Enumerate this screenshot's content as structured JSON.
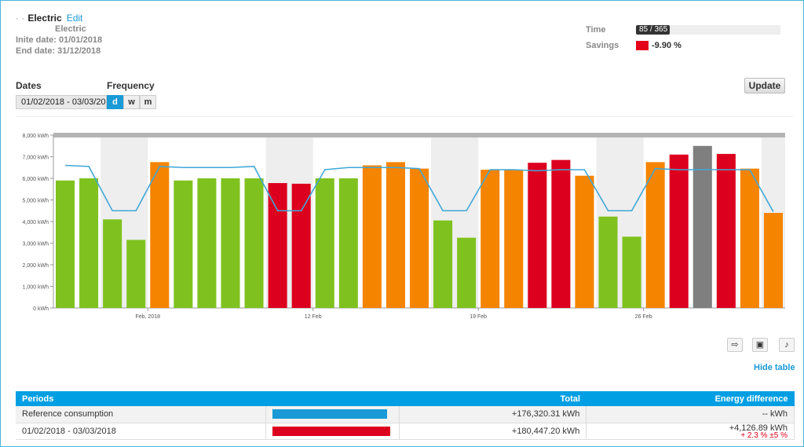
{
  "header": {
    "mask": "· ·",
    "title": "Electric",
    "edit_label": "Edit",
    "subtitle": "Electric",
    "start_date": "Inite date: 01/01/2018",
    "end_date": "End date: 31/12/2018"
  },
  "meta": {
    "time_label": "Time",
    "time_value": "85 / 365",
    "time_fraction": 0.233,
    "savings_label": "Savings",
    "savings_value": "-9.90 %",
    "savings_color": "#e2001a"
  },
  "controls": {
    "dates_label": "Dates",
    "frequency_label": "Frequency",
    "date_range_value": "01/02/2018 - 03/03/20",
    "frequency_options": [
      "d",
      "w",
      "m"
    ],
    "frequency_selected": "d",
    "update_label": "Update"
  },
  "colors": {
    "green": "#7fc21f",
    "orange": "#f58400",
    "red": "#dc001e",
    "gray": "#7f7f7f",
    "line": "#40a8d8",
    "accent": "#009fe3"
  },
  "chart_data": {
    "type": "bar",
    "y_unit": "kWh",
    "ylim": [
      0,
      8000
    ],
    "yticks": [
      "0 kWh",
      "1,000 kWh",
      "2,000 kWh",
      "3,000 kWh",
      "4,000 kWh",
      "5,000 kWh",
      "6,000 kWh",
      "7,000 kWh",
      "8,000 kWh"
    ],
    "x_ticks": [
      {
        "index": 4,
        "label": "Feb, 2018"
      },
      {
        "index": 11,
        "label": "12 Feb"
      },
      {
        "index": 18,
        "label": "19 Feb"
      },
      {
        "index": 25,
        "label": "26 Feb"
      }
    ],
    "weekend_pairs": [
      [
        2,
        3
      ],
      [
        9,
        10
      ],
      [
        16,
        17
      ],
      [
        23,
        24
      ],
      [
        30,
        31
      ]
    ],
    "bars": [
      {
        "value": 5900,
        "status": "green"
      },
      {
        "value": 6000,
        "status": "green"
      },
      {
        "value": 4100,
        "status": "green"
      },
      {
        "value": 3150,
        "status": "green"
      },
      {
        "value": 6750,
        "status": "orange"
      },
      {
        "value": 5900,
        "status": "green"
      },
      {
        "value": 6000,
        "status": "green"
      },
      {
        "value": 6000,
        "status": "green"
      },
      {
        "value": 6000,
        "status": "green"
      },
      {
        "value": 5780,
        "status": "red"
      },
      {
        "value": 5750,
        "status": "red"
      },
      {
        "value": 6000,
        "status": "green"
      },
      {
        "value": 6000,
        "status": "green"
      },
      {
        "value": 6600,
        "status": "orange"
      },
      {
        "value": 6750,
        "status": "orange"
      },
      {
        "value": 6450,
        "status": "orange"
      },
      {
        "value": 4050,
        "status": "green"
      },
      {
        "value": 3250,
        "status": "green"
      },
      {
        "value": 6400,
        "status": "orange"
      },
      {
        "value": 6400,
        "status": "orange"
      },
      {
        "value": 6720,
        "status": "red"
      },
      {
        "value": 6850,
        "status": "red"
      },
      {
        "value": 6120,
        "status": "orange"
      },
      {
        "value": 4230,
        "status": "green"
      },
      {
        "value": 3300,
        "status": "green"
      },
      {
        "value": 6750,
        "status": "orange"
      },
      {
        "value": 7100,
        "status": "red"
      },
      {
        "value": 7500,
        "status": "gray"
      },
      {
        "value": 7130,
        "status": "red"
      },
      {
        "value": 6450,
        "status": "orange"
      },
      {
        "value": 4400,
        "status": "orange"
      }
    ],
    "reference_line": [
      6600,
      6550,
      4500,
      4500,
      6550,
      6500,
      6500,
      6500,
      6550,
      4500,
      4500,
      6400,
      6500,
      6500,
      6500,
      6450,
      4500,
      4500,
      6400,
      6400,
      6350,
      6400,
      6400,
      4500,
      4500,
      6450,
      6400,
      6400,
      6400,
      6400,
      4450
    ]
  },
  "toolbar": {
    "export_icon": "export-icon",
    "camera_icon": "camera-icon",
    "music_icon": "music-note-icon"
  },
  "hide_table_label": "Hide table",
  "table": {
    "headers": [
      "Periods",
      "",
      "Total",
      "Energy difference"
    ],
    "rows": [
      {
        "period": "Reference consumption",
        "bar_color": "#1a9ad6",
        "bar_fraction": 0.977,
        "total": "+176,320.31 kWh",
        "difference": "-- kWh",
        "pct": ""
      },
      {
        "period": "01/02/2018 - 03/03/2018",
        "bar_color": "#dc001e",
        "bar_fraction": 1.0,
        "total": "+180,447.20 kWh",
        "difference": "+4,126.89 kWh",
        "pct": "+ 2.3 % ±5 %"
      }
    ]
  }
}
